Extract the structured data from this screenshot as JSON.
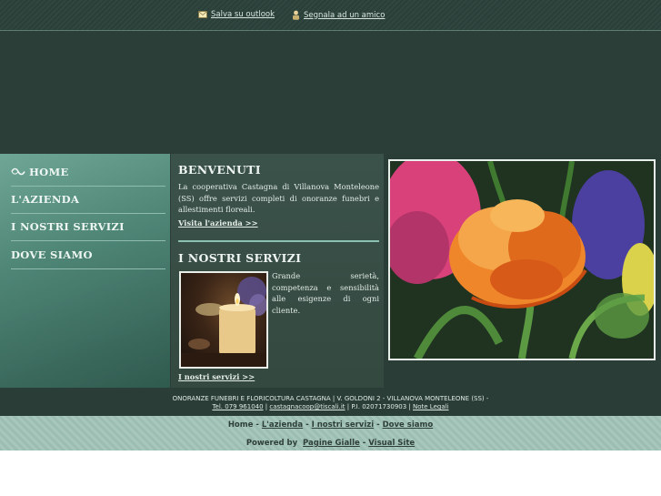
{
  "topbar": {
    "save_label": "Salva su outlook",
    "save_icon": "envelope-icon",
    "share_label": "Segnala ad un amico",
    "share_icon": "person-icon"
  },
  "nav": {
    "items": [
      {
        "label": "HOME",
        "icon": "arrow-icon"
      },
      {
        "label": "L'AZIENDA"
      },
      {
        "label": "I NOSTRI SERVIZI"
      },
      {
        "label": "DOVE SIAMO"
      }
    ]
  },
  "welcome": {
    "title": "BENVENUTI",
    "text": "La cooperativa Castagna di Villanova Monteleone (SS) offre servizi completi di onoranze funebri e allestimenti floreali.",
    "link": "Visita l'azienda >>"
  },
  "services": {
    "title": "I NOSTRI SERVIZI",
    "text": "Grande serietà, competenza e sensibilità alle esigenze di ogni cliente.",
    "link": "I nostri servizi >>"
  },
  "footer": {
    "line1": "ONORANZE FUNEBRI E FLORICOLTURA CASTAGNA | V. GOLDONI 2 - VILLANOVA MONTELEONE (SS) -",
    "tel": "Tel. 079 961040",
    "sep1": " | ",
    "email": "castagnacoop@tiscali.it",
    "piva": " | P.I. 02071730903 | ",
    "legal": "Note Legali"
  },
  "bottom": {
    "home": "Home",
    "azienda": "L'azienda",
    "servizi": "I nostri servizi",
    "dove": "Dove siamo",
    "powered": "Powered by",
    "pagine": "Pagine Gialle",
    "visual": "Visual Site"
  }
}
